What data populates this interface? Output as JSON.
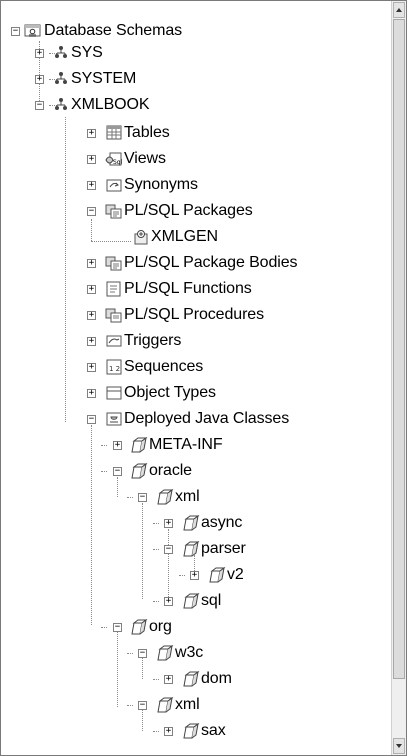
{
  "tree": {
    "root": {
      "label": "Database Schemas",
      "icon": "database-icon"
    },
    "schemas": [
      {
        "label": "SYS",
        "icon": "schema-icon",
        "expanded": false
      },
      {
        "label": "SYSTEM",
        "icon": "schema-icon",
        "expanded": false
      },
      {
        "label": "XMLBOOK",
        "icon": "schema-icon",
        "expanded": true
      }
    ],
    "xmlbook_children": [
      {
        "label": "Tables",
        "icon": "tables-icon"
      },
      {
        "label": "Views",
        "icon": "views-icon"
      },
      {
        "label": "Synonyms",
        "icon": "synonyms-icon"
      },
      {
        "label": "PL/SQL Packages",
        "icon": "plsql-package-icon"
      },
      {
        "label": "XMLGEN",
        "icon": "package-item-icon"
      },
      {
        "label": "PL/SQL Package Bodies",
        "icon": "plsql-package-body-icon"
      },
      {
        "label": "PL/SQL Functions",
        "icon": "plsql-function-icon"
      },
      {
        "label": "PL/SQL Procedures",
        "icon": "plsql-procedure-icon"
      },
      {
        "label": "Triggers",
        "icon": "triggers-icon"
      },
      {
        "label": "Sequences",
        "icon": "sequences-icon"
      },
      {
        "label": "Object Types",
        "icon": "object-types-icon"
      },
      {
        "label": "Deployed Java Classes",
        "icon": "java-classes-icon"
      }
    ],
    "java_packages": [
      {
        "label": "META-INF",
        "icon": "java-package-icon"
      },
      {
        "label": "oracle",
        "icon": "java-package-icon"
      },
      {
        "label": "xml",
        "icon": "java-package-icon"
      },
      {
        "label": "async",
        "icon": "java-package-icon"
      },
      {
        "label": "parser",
        "icon": "java-package-icon"
      },
      {
        "label": "v2",
        "icon": "java-package-icon"
      },
      {
        "label": "sql",
        "icon": "java-package-icon"
      },
      {
        "label": "org",
        "icon": "java-package-icon"
      },
      {
        "label": "w3c",
        "icon": "java-package-icon"
      },
      {
        "label": "dom",
        "icon": "java-package-icon"
      },
      {
        "label": "xml",
        "icon": "java-package-icon"
      },
      {
        "label": "sax",
        "icon": "java-package-icon"
      }
    ],
    "toggle_expand_glyph": "+",
    "toggle_collapse_glyph": "−"
  },
  "scrollbar": {
    "position_fraction": 0.0
  }
}
